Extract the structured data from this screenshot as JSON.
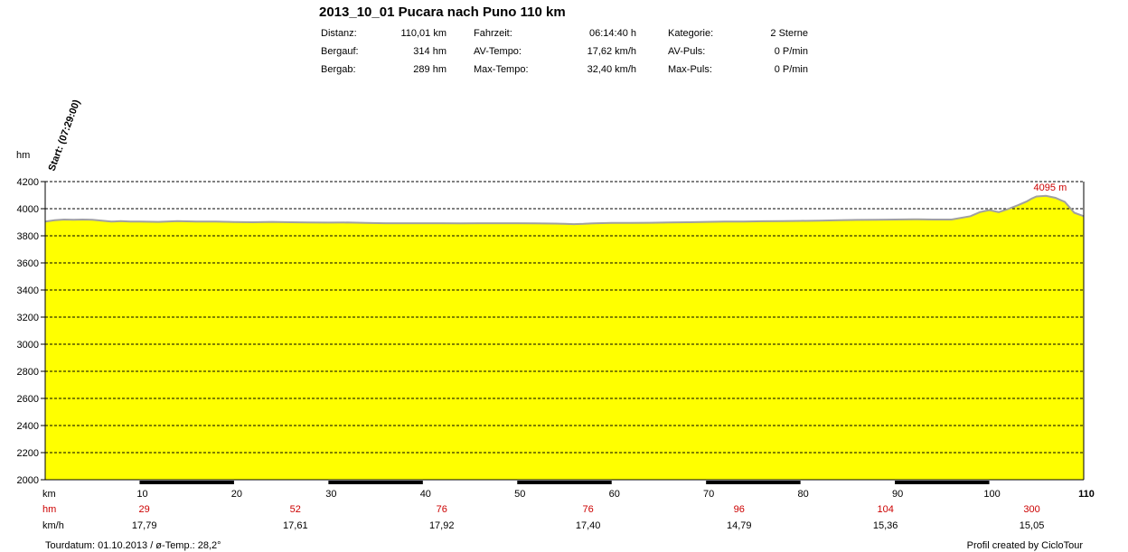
{
  "header": {
    "title": "2013_10_01 Pucara nach Puno 110 km",
    "stats": [
      {
        "label": "Distanz:",
        "value": "110,01 km"
      },
      {
        "label": "Bergauf:",
        "value": "314 hm"
      },
      {
        "label": "Bergab:",
        "value": "289 hm"
      },
      {
        "label": "Fahrzeit:",
        "value": "06:14:40 h"
      },
      {
        "label": "AV-Tempo:",
        "value": "17,62 km/h"
      },
      {
        "label": "Max-Tempo:",
        "value": "32,40 km/h"
      },
      {
        "label": "Kategorie:",
        "value": "2 Sterne"
      },
      {
        "label": "AV-Puls:",
        "value": "0 P/min"
      },
      {
        "label": "Max-Puls:",
        "value": "0 P/min"
      }
    ]
  },
  "footer": {
    "left": "Tourdatum: 01.10.2013  /  ø-Temp.: 28,2°",
    "right": "Profil created by CicloTour"
  },
  "colors": {
    "fill": "#ffff00",
    "line": "#a0a0a0",
    "accent_red": "#cc0000",
    "band": "#000000"
  },
  "chart_data": {
    "type": "area",
    "ylabel": "hm",
    "xlabel": "km",
    "start_label": "Start: (07:29:00)",
    "max_label": "4095 m",
    "max_point": {
      "x": 104.5,
      "y": 4095
    },
    "xlim": [
      0,
      110
    ],
    "ylim": [
      2000,
      4200
    ],
    "y_ticks": [
      2000,
      2200,
      2400,
      2600,
      2800,
      3000,
      3200,
      3400,
      3600,
      3800,
      4000,
      4200
    ],
    "x_ticks": [
      10,
      20,
      30,
      40,
      50,
      60,
      70,
      80,
      90,
      100,
      110
    ],
    "grid": true,
    "profile": {
      "x": [
        0,
        1,
        2,
        3,
        4,
        5,
        6,
        7,
        8,
        9,
        10,
        12,
        14,
        16,
        18,
        20,
        22,
        24,
        26,
        28,
        30,
        32,
        34,
        36,
        38,
        40,
        42,
        44,
        46,
        48,
        50,
        52,
        54,
        55,
        56,
        57,
        58,
        60,
        62,
        64,
        66,
        68,
        70,
        72,
        74,
        76,
        78,
        80,
        82,
        84,
        86,
        88,
        90,
        92,
        94,
        96,
        98,
        99,
        100,
        101,
        102,
        103,
        104,
        104.5,
        105,
        106,
        107,
        108,
        109,
        110
      ],
      "y": [
        3905,
        3915,
        3920,
        3918,
        3920,
        3918,
        3912,
        3905,
        3908,
        3905,
        3905,
        3903,
        3908,
        3905,
        3905,
        3902,
        3900,
        3903,
        3900,
        3898,
        3897,
        3898,
        3895,
        3893,
        3893,
        3893,
        3893,
        3892,
        3893,
        3893,
        3893,
        3892,
        3890,
        3888,
        3886,
        3888,
        3892,
        3895,
        3895,
        3896,
        3898,
        3900,
        3903,
        3905,
        3905,
        3907,
        3908,
        3910,
        3912,
        3915,
        3917,
        3918,
        3920,
        3922,
        3920,
        3920,
        3945,
        3975,
        3990,
        3975,
        3998,
        4025,
        4055,
        4075,
        4090,
        4095,
        4080,
        4050,
        3970,
        3945,
        3940
      ]
    },
    "segment_bands": [
      [
        10,
        20
      ],
      [
        30,
        40
      ],
      [
        50,
        60
      ],
      [
        70,
        80
      ],
      [
        90,
        100
      ]
    ],
    "segments": [
      {
        "x": 10.5,
        "hm": "29",
        "kmh": "17,79"
      },
      {
        "x": 26.5,
        "hm": "52",
        "kmh": "17,61"
      },
      {
        "x": 42,
        "hm": "76",
        "kmh": "17,92"
      },
      {
        "x": 57.5,
        "hm": "76",
        "kmh": "17,40"
      },
      {
        "x": 73.5,
        "hm": "96",
        "kmh": "14,79"
      },
      {
        "x": 89,
        "hm": "104",
        "kmh": "15,36"
      },
      {
        "x": 104.5,
        "hm": "300",
        "kmh": "15,05"
      }
    ],
    "row_labels": {
      "km": "km",
      "hm": "hm",
      "kmh": "km/h"
    }
  }
}
